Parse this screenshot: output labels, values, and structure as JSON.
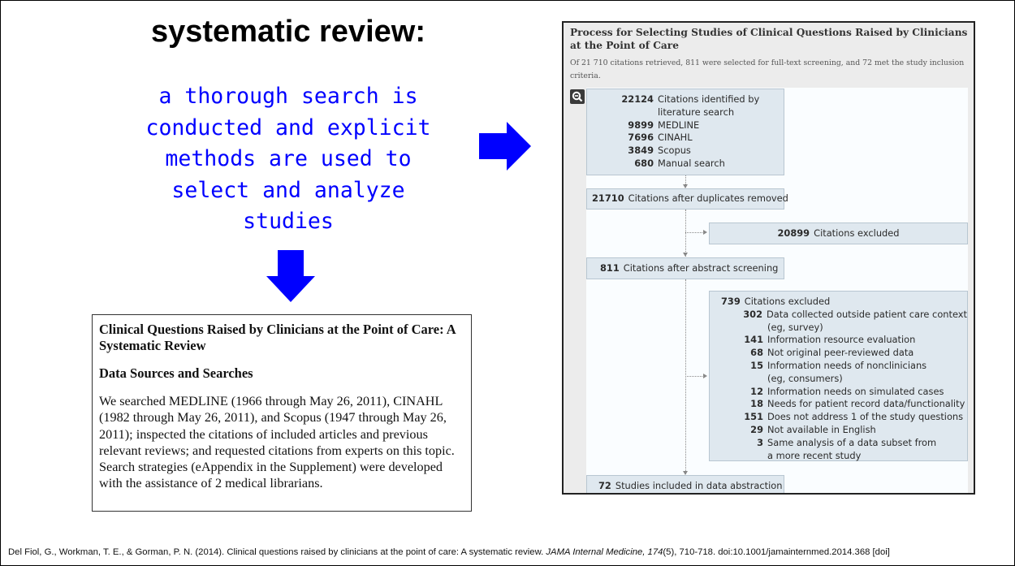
{
  "slide": {
    "title": "systematic review:",
    "definition": "a thorough search is\nconducted and explicit\nmethods are used to\nselect and analyze\nstudies",
    "accent_color": "#0000ff"
  },
  "abstract_excerpt": {
    "title": "Clinical Questions Raised by Clinicians at the Point of Care: A Systematic Review",
    "section_heading": "Data Sources and Searches",
    "body": "We searched MEDLINE (1966 through May 26, 2011), CINAHL (1982 through May 26, 2011), and Scopus (1947 through May 26, 2011); inspected the citations of included articles and previous relevant reviews; and requested citations from experts on this topic. Search strategies (eAppendix in the Supplement) were developed with the assistance of 2 medical librarians."
  },
  "flowchart": {
    "title": "Process for Selecting Studies of Clinical Questions Raised by Clinicians at the Point of Care",
    "subtitle": "Of 21 710 citations retrieved, 811 were selected for full-text screening, and 72 met the study inclusion criteria.",
    "zoom_icon": "magnifier-icon",
    "identified": {
      "rows": [
        {
          "num": "22124",
          "label": "Citations identified by"
        },
        {
          "num": "",
          "label": "literature search"
        },
        {
          "num": "9899",
          "label": "MEDLINE"
        },
        {
          "num": "7696",
          "label": "CINAHL"
        },
        {
          "num": "3849",
          "label": "Scopus"
        },
        {
          "num": "680",
          "label": "Manual search"
        }
      ]
    },
    "after_duplicates": {
      "num": "21710",
      "label": "Citations after duplicates removed"
    },
    "excluded_1": {
      "num": "20899",
      "label": "Citations excluded"
    },
    "after_abstract": {
      "num": "811",
      "label": "Citations after abstract screening"
    },
    "excluded_2": {
      "header": {
        "num": "739",
        "label": "Citations excluded"
      },
      "rows": [
        {
          "num": "302",
          "label": "Data collected outside patient care context"
        },
        {
          "num": "",
          "label": "(eg, survey)"
        },
        {
          "num": "141",
          "label": "Information resource evaluation"
        },
        {
          "num": "68",
          "label": "Not original peer-reviewed data"
        },
        {
          "num": "15",
          "label": "Information needs of nonclinicians"
        },
        {
          "num": "",
          "label": "(eg, consumers)"
        },
        {
          "num": "12",
          "label": "Information needs on simulated cases"
        },
        {
          "num": "18",
          "label": "Needs for patient record data/functionality"
        },
        {
          "num": "151",
          "label": "Does not address 1 of the study questions"
        },
        {
          "num": "29",
          "label": "Not available in English"
        },
        {
          "num": "3",
          "label": "Same analysis of a data subset from"
        },
        {
          "num": "",
          "label": "a more recent study"
        }
      ]
    },
    "included": {
      "num": "72",
      "label": "Studies included in data abstraction"
    }
  },
  "citation": {
    "pre": "Del Fiol, G., Workman, T. E., & Gorman, P. N. (2014). Clinical questions raised by clinicians at the point of care: A systematic review. ",
    "journal": "JAMA Internal Medicine,",
    "volume": " 174",
    "post": "(5), 710-718. doi:10.1001/jamainternmed.2014.368 [doi]"
  }
}
